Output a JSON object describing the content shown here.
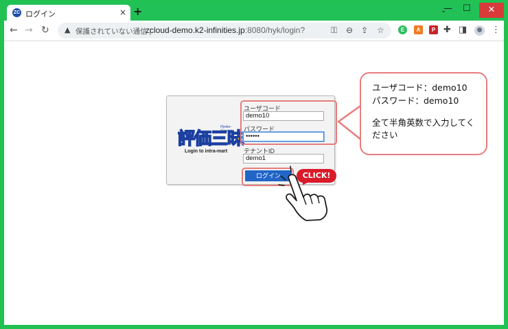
{
  "browser": {
    "tab": {
      "favicon_text": "ZC",
      "title": "ログイン",
      "close": "×"
    },
    "new_tab": "+",
    "tab_list": "⌄",
    "window_controls": {
      "minimize": "—",
      "maximize": "☐",
      "close": "✕"
    },
    "nav": {
      "back": "←",
      "forward": "→",
      "reload": "↻"
    },
    "omnibox": {
      "warning_icon": "▲",
      "security_text": "保護されていない通信 |",
      "url_host": "zcloud-demo.k2-infinities.jp",
      "url_path": ":8080/hyk/login?"
    },
    "omni_icons": [
      "key-icon",
      "zoom-icon",
      "share-icon",
      "star-icon"
    ],
    "extensions": [
      {
        "name": "evernote-extension-icon",
        "label": "E",
        "color": "#2dbe60"
      },
      {
        "name": "a-extension-icon",
        "label": "A",
        "color": "#f27b21"
      },
      {
        "name": "pdf-extension-icon",
        "label": "P",
        "color": "#c8242b"
      }
    ],
    "toolbar_glyphs": {
      "puzzle": "✚",
      "sidepanel": "◨",
      "menu": "⋮"
    }
  },
  "login": {
    "logo": {
      "text": "評価三昧",
      "sub": "Hyoka-Sanmai",
      "caption": "Login to intra-mart"
    },
    "user_code": {
      "label": "ユーザコード",
      "value": "demo10"
    },
    "password": {
      "label": "パスワード",
      "value": "••••••"
    },
    "tenant": {
      "label": "テナントID",
      "value": "demo1"
    },
    "submit_label": "ログイン"
  },
  "annotation": {
    "line1": "ユーザコード：demo10",
    "line2": "パスワード：demo10",
    "line3": "全て半角英数で入力してく",
    "line4": "ださい",
    "click_badge": "CLICK!",
    "highlight_color": "#e87c7c"
  }
}
